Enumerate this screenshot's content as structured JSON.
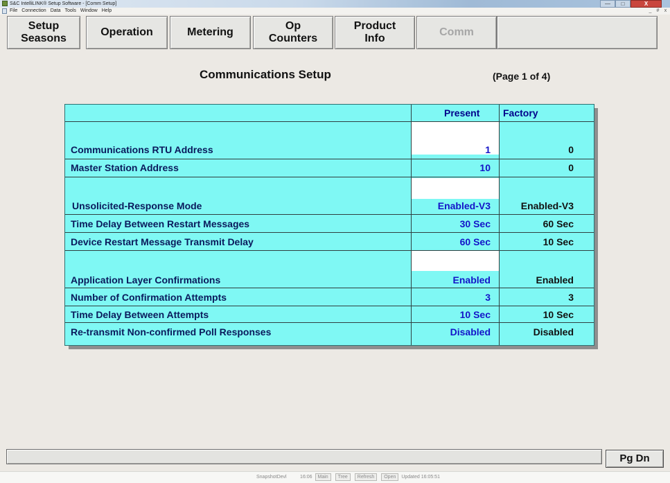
{
  "window": {
    "title": "S&C IntelliLINK® Setup Software - [Comm Setup]",
    "min_label": "—",
    "max_label": "□",
    "close_label": "X",
    "mdi_min": "_",
    "mdi_restore": "#",
    "mdi_close": "x"
  },
  "menu": [
    "File",
    "Connection",
    "Data",
    "Tools",
    "Window",
    "Help"
  ],
  "nav": [
    {
      "label": "Setup\nSeasons",
      "enabled": true
    },
    {
      "label": "Operation",
      "enabled": true
    },
    {
      "label": "Metering",
      "enabled": true
    },
    {
      "label": "Op\nCounters",
      "enabled": true
    },
    {
      "label": "Product\nInfo",
      "enabled": true
    },
    {
      "label": "Comm",
      "enabled": false
    },
    {
      "label": "",
      "enabled": true
    }
  ],
  "page": {
    "title": "Communications Setup",
    "page_number": "(Page 1 of 4)"
  },
  "table": {
    "col_present": "Present",
    "col_factory": "Factory",
    "rows": [
      {
        "label": "Communications RTU Address",
        "present": "1",
        "factory": "0"
      },
      {
        "label": "Master Station Address",
        "present": "10",
        "factory": "0"
      },
      {
        "label": "Unsolicited-Response Mode",
        "present": "Enabled-V3",
        "factory": "Enabled-V3"
      },
      {
        "label": "Time Delay Between Restart Messages",
        "present": "30 Sec",
        "factory": "60 Sec"
      },
      {
        "label": "Device Restart Message Transmit Delay",
        "present": "60 Sec",
        "factory": "10 Sec"
      },
      {
        "label": "Application Layer Confirmations",
        "present": "Enabled",
        "factory": "Enabled"
      },
      {
        "label": "Number of Confirmation Attempts",
        "present": "3",
        "factory": "3"
      },
      {
        "label": "Time Delay Between Attempts",
        "present": "10 Sec",
        "factory": "10 Sec"
      },
      {
        "label": "Re-transmit Non-confirmed Poll Responses",
        "present": "Disabled",
        "factory": "Disabled"
      }
    ]
  },
  "footer": {
    "status_text": "",
    "pgdn_label": "Pg Dn"
  },
  "taskbar": {
    "items": [
      "SnapshotDevl",
      "16:06",
      "Main",
      "Tree",
      "Refresh",
      "Open",
      "Updated 16:05:51"
    ]
  },
  "colors": {
    "table_bg": "#7ff8f4",
    "present_text": "#1414c8",
    "close_button": "#c9463d"
  }
}
